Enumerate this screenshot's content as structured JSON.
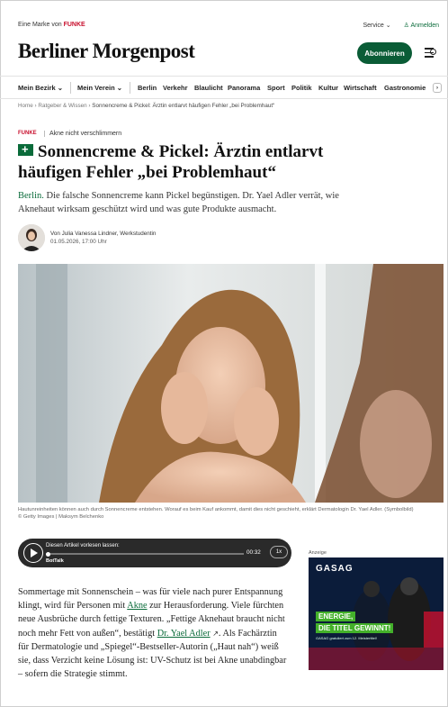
{
  "topbar": {
    "brand_prefix": "Eine Marke von",
    "brand_name": "FUNKE",
    "service": "Service",
    "login": "Anmelden"
  },
  "header": {
    "logo": "Berliner Morgenpost",
    "subscribe": "Abonnieren"
  },
  "nav": {
    "items": [
      "Mein Bezirk",
      "Mein Verein",
      "Berlin",
      "Verkehr",
      "Blaulicht",
      "Panorama",
      "Sport",
      "Politik",
      "Kultur",
      "Wirtschaft",
      "Gastronomie"
    ]
  },
  "breadcrumb": {
    "home": "Home",
    "section": "Ratgeber & Wissen",
    "current": "Sonnencreme & Pickel: Ärztin entlarvt häufigen Fehler „bei Problemhaut“"
  },
  "article": {
    "source_tag": "FUNKE",
    "kicker": "Akne nicht verschlimmern",
    "headline": "Sonnencreme & Pickel: Ärztin entlarvt häufigen Fehler „bei Problemhaut“",
    "lead_city": "Berlin.",
    "lead": "Die falsche Sonnencreme kann Pickel begünstigen. Dr. Yael Adler verrät, wie Aknehaut wirksam geschützt wird und was gute Produkte ausmacht.",
    "author": "Von Julia Vanessa Lindner, Werkstudentin",
    "date": "01.05.2026, 17:00 Uhr",
    "caption": "Hautunreinheiten können auch durch Sonnencreme entstehen. Worauf es beim Kauf ankommt, damit dies nicht geschieht, erklärt Dermatologin Dr. Yael Adler. (Symbolbild)",
    "credit": "© Getty Images | Maksym Belchenko",
    "body": {
      "p1_a": "Sommertage mit Sonnenschein – was für viele nach purer Entspannung klingt, wird für Personen mit ",
      "link1": "Akne",
      "p1_b": " zur Herausforderung. Viele fürchten neue Ausbrüche durch fettige Texturen. „Fettige Aknehaut braucht nicht noch mehr Fett von außen“, bestätigt ",
      "link2": "Dr. Yael Adler",
      "p1_c": ". Als Fachärztin für Dermatologie und „Spiegel“-Bestseller-Autorin („Haut nah“) weiß sie, dass Verzicht keine Lösung ist: UV-Schutz ist bei Akne unabdingbar – sofern die Strategie stimmt."
    }
  },
  "player": {
    "title": "Diesen Artikel vorlesen lassen:",
    "brand": "BotTalk",
    "time": "00:32",
    "speed": "1x"
  },
  "ad": {
    "label": "Anzeige",
    "brand": "GASAG",
    "line1": "ENERGIE,",
    "line2": "DIE TITEL GEWINNT!",
    "fine": "GASAG gratuliert zum 12. Meistertitel!"
  },
  "colors": {
    "brand_green": "#0a6b3a",
    "funke_red": "#c8102e"
  }
}
